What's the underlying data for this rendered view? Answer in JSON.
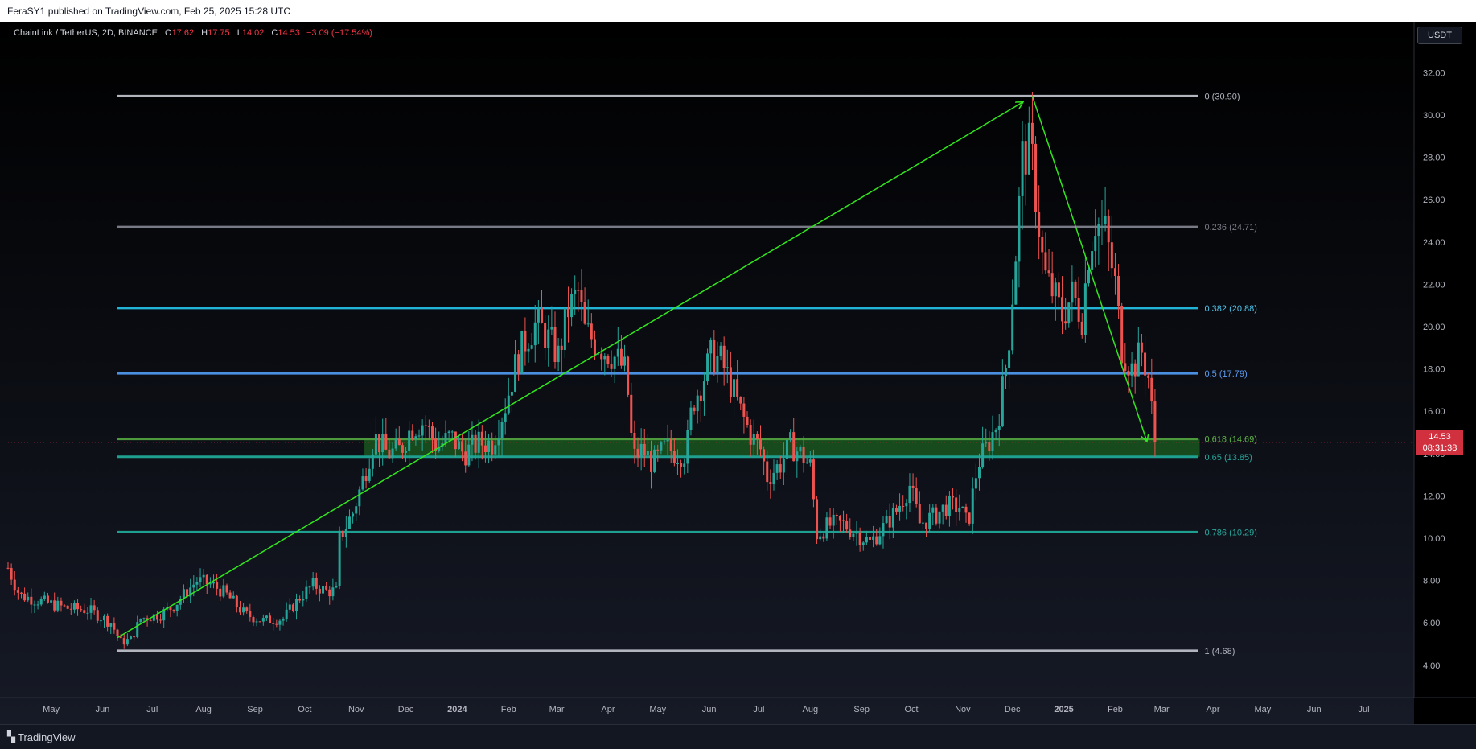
{
  "header": {
    "published_text": "FeraSY1 published on TradingView.com, Feb 25, 2025 15:28 UTC"
  },
  "footer": {
    "brand_text": "TradingView",
    "logo_icon": "tradingview-logo-icon"
  },
  "legend": {
    "symbol": "ChainLink / TetherUS, 2D, BINANCE",
    "open_label": "O",
    "open": "17.62",
    "high_label": "H",
    "high": "17.75",
    "low_label": "L",
    "low": "14.02",
    "close_label": "C",
    "close": "14.53",
    "change": "−3.09 (−17.54%)"
  },
  "currency_button": "USDT",
  "last_price": {
    "price": "14.53",
    "countdown": "08:31:38"
  },
  "colors": {
    "background": "#000000",
    "up": "#26a69a",
    "down": "#ef5350",
    "trendline": "#32e61e",
    "zone": "#1b5e20"
  },
  "chart_data": {
    "type": "candlestick",
    "title": "ChainLink / TetherUS, 2D, BINANCE",
    "ylim": [
      2.7,
      33.5
    ],
    "xlim": [
      "2023-04-05",
      "2025-07-25"
    ],
    "y_ticks": [
      "4.00",
      "6.00",
      "8.00",
      "10.00",
      "12.00",
      "14.00",
      "16.00",
      "18.00",
      "20.00",
      "22.00",
      "24.00",
      "26.00",
      "28.00",
      "30.00",
      "32.00"
    ],
    "x_ticks": [
      {
        "label": "May",
        "date": "2023-05-01",
        "bold": false
      },
      {
        "label": "Jun",
        "date": "2023-06-01",
        "bold": false
      },
      {
        "label": "Jul",
        "date": "2023-07-01",
        "bold": false
      },
      {
        "label": "Aug",
        "date": "2023-08-01",
        "bold": false
      },
      {
        "label": "Sep",
        "date": "2023-09-01",
        "bold": false
      },
      {
        "label": "Oct",
        "date": "2023-10-01",
        "bold": false
      },
      {
        "label": "Nov",
        "date": "2023-11-01",
        "bold": false
      },
      {
        "label": "Dec",
        "date": "2023-12-01",
        "bold": false
      },
      {
        "label": "2024",
        "date": "2024-01-01",
        "bold": true
      },
      {
        "label": "Feb",
        "date": "2024-02-01",
        "bold": false
      },
      {
        "label": "Mar",
        "date": "2024-03-01",
        "bold": false
      },
      {
        "label": "Apr",
        "date": "2024-04-01",
        "bold": false
      },
      {
        "label": "May",
        "date": "2024-05-01",
        "bold": false
      },
      {
        "label": "Jun",
        "date": "2024-06-01",
        "bold": false
      },
      {
        "label": "Jul",
        "date": "2024-07-01",
        "bold": false
      },
      {
        "label": "Aug",
        "date": "2024-08-01",
        "bold": false
      },
      {
        "label": "Sep",
        "date": "2024-09-01",
        "bold": false
      },
      {
        "label": "Oct",
        "date": "2024-10-01",
        "bold": false
      },
      {
        "label": "Nov",
        "date": "2024-11-01",
        "bold": false
      },
      {
        "label": "Dec",
        "date": "2024-12-01",
        "bold": false
      },
      {
        "label": "2025",
        "date": "2025-01-01",
        "bold": true
      },
      {
        "label": "Feb",
        "date": "2025-02-01",
        "bold": false
      },
      {
        "label": "Mar",
        "date": "2025-03-01",
        "bold": false
      },
      {
        "label": "Apr",
        "date": "2025-04-01",
        "bold": false
      },
      {
        "label": "May",
        "date": "2025-05-01",
        "bold": false
      },
      {
        "label": "Jun",
        "date": "2025-06-01",
        "bold": false
      },
      {
        "label": "Jul",
        "date": "2025-07-01",
        "bold": false
      }
    ],
    "fib_levels": [
      {
        "ratio": "0",
        "value": 30.9,
        "label": "0 (30.90)",
        "color": "#b2b5be",
        "label_color": "#b2b5be"
      },
      {
        "ratio": "0.236",
        "value": 24.71,
        "label": "0.236 (24.71)",
        "color": "#787b86",
        "label_color": "#787b86"
      },
      {
        "ratio": "0.382",
        "value": 20.88,
        "label": "0.382 (20.88)",
        "color": "#22b4d6",
        "label_color": "#4fc3e8"
      },
      {
        "ratio": "0.5",
        "value": 17.79,
        "label": "0.5 (17.79)",
        "color": "#4a8fe0",
        "label_color": "#5b9cf0"
      },
      {
        "ratio": "0.618",
        "value": 14.69,
        "label": "0.618 (14.69)",
        "color": "#4c9a3c",
        "label_color": "#5fb548"
      },
      {
        "ratio": "0.65",
        "value": 13.85,
        "label": "0.65 (13.85)",
        "color": "#1e9f8f",
        "label_color": "#26a69a"
      },
      {
        "ratio": "0.786",
        "value": 10.29,
        "label": "0.786 (10.29)",
        "color": "#1e9f8f",
        "label_color": "#26a69a"
      },
      {
        "ratio": "1",
        "value": 4.68,
        "label": "1 (4.68)",
        "color": "#b2b5be",
        "label_color": "#b2b5be"
      }
    ],
    "fib_start_date": "2023-06-10",
    "fib_end_date": "2025-03-23",
    "zone": {
      "from_date": "2023-11-06",
      "to_date": "2025-03-24",
      "low": 13.85,
      "high": 14.69
    },
    "arrows": [
      {
        "from": {
          "date": "2023-06-10",
          "value": 5.3
        },
        "to": {
          "date": "2024-12-07",
          "value": 30.6
        }
      },
      {
        "from": {
          "date": "2024-12-13",
          "value": 30.9
        },
        "to": {
          "date": "2025-02-20",
          "value": 14.6
        }
      }
    ],
    "anchors": [
      [
        "2023-04-05",
        8.6
      ],
      [
        "2023-04-12",
        7.3
      ],
      [
        "2023-04-26",
        7.0
      ],
      [
        "2023-05-10",
        6.7
      ],
      [
        "2023-05-24",
        6.6
      ],
      [
        "2023-06-06",
        6.0
      ],
      [
        "2023-06-12",
        5.1
      ],
      [
        "2023-06-18",
        5.2
      ],
      [
        "2023-06-24",
        6.2
      ],
      [
        "2023-07-06",
        6.4
      ],
      [
        "2023-07-14",
        6.8
      ],
      [
        "2023-07-22",
        7.5
      ],
      [
        "2023-07-28",
        8.0
      ],
      [
        "2023-08-06",
        7.8
      ],
      [
        "2023-08-14",
        7.4
      ],
      [
        "2023-08-20",
        6.9
      ],
      [
        "2023-08-26",
        6.4
      ],
      [
        "2023-09-06",
        6.1
      ],
      [
        "2023-09-18",
        6.2
      ],
      [
        "2023-09-28",
        7.2
      ],
      [
        "2023-10-06",
        7.8
      ],
      [
        "2023-10-14",
        7.5
      ],
      [
        "2023-10-20",
        7.5
      ],
      [
        "2023-10-22",
        10.0
      ],
      [
        "2023-10-30",
        11.2
      ],
      [
        "2023-11-06",
        13.0
      ],
      [
        "2023-11-12",
        14.8
      ],
      [
        "2023-11-20",
        14.0
      ],
      [
        "2023-11-28",
        14.2
      ],
      [
        "2023-12-04",
        15.2
      ],
      [
        "2023-12-12",
        15.5
      ],
      [
        "2023-12-20",
        14.3
      ],
      [
        "2023-12-28",
        14.8
      ],
      [
        "2024-01-05",
        14.0
      ],
      [
        "2024-01-14",
        14.5
      ],
      [
        "2024-01-22",
        14.5
      ],
      [
        "2024-01-30",
        16.3
      ],
      [
        "2024-02-06",
        18.4
      ],
      [
        "2024-02-12",
        19.5
      ],
      [
        "2024-02-18",
        20.2
      ],
      [
        "2024-02-26",
        19.3
      ],
      [
        "2024-03-02",
        18.6
      ],
      [
        "2024-03-08",
        20.8
      ],
      [
        "2024-03-14",
        21.6
      ],
      [
        "2024-03-18",
        19.8
      ],
      [
        "2024-03-24",
        19.3
      ],
      [
        "2024-03-30",
        18.9
      ],
      [
        "2024-04-06",
        18.5
      ],
      [
        "2024-04-12",
        17.8
      ],
      [
        "2024-04-16",
        13.8
      ],
      [
        "2024-04-22",
        14.2
      ],
      [
        "2024-04-28",
        13.5
      ],
      [
        "2024-05-06",
        14.3
      ],
      [
        "2024-05-12",
        14.0
      ],
      [
        "2024-05-18",
        14.0
      ],
      [
        "2024-05-22",
        16.4
      ],
      [
        "2024-05-28",
        17.4
      ],
      [
        "2024-06-02",
        18.6
      ],
      [
        "2024-06-08",
        18.4
      ],
      [
        "2024-06-14",
        17.3
      ],
      [
        "2024-06-20",
        16.0
      ],
      [
        "2024-06-26",
        14.9
      ],
      [
        "2024-07-02",
        14.2
      ],
      [
        "2024-07-06",
        12.9
      ],
      [
        "2024-07-14",
        13.5
      ],
      [
        "2024-07-20",
        14.4
      ],
      [
        "2024-07-26",
        14.0
      ],
      [
        "2024-08-01",
        13.4
      ],
      [
        "2024-08-05",
        10.2
      ],
      [
        "2024-08-12",
        10.6
      ],
      [
        "2024-08-20",
        10.7
      ],
      [
        "2024-08-28",
        10.3
      ],
      [
        "2024-09-06",
        9.8
      ],
      [
        "2024-09-14",
        10.5
      ],
      [
        "2024-09-22",
        11.3
      ],
      [
        "2024-09-30",
        12.5
      ],
      [
        "2024-10-06",
        10.7
      ],
      [
        "2024-10-14",
        11.0
      ],
      [
        "2024-10-22",
        11.5
      ],
      [
        "2024-10-30",
        11.5
      ],
      [
        "2024-11-04",
        10.6
      ],
      [
        "2024-11-10",
        13.5
      ],
      [
        "2024-11-16",
        14.4
      ],
      [
        "2024-11-22",
        15.5
      ],
      [
        "2024-11-28",
        18.6
      ],
      [
        "2024-12-03",
        23.5
      ],
      [
        "2024-12-07",
        28.0
      ],
      [
        "2024-12-12",
        28.5
      ],
      [
        "2024-12-16",
        25.5
      ],
      [
        "2024-12-20",
        22.5
      ],
      [
        "2024-12-26",
        21.5
      ],
      [
        "2024-12-31",
        20.5
      ],
      [
        "2025-01-06",
        21.5
      ],
      [
        "2025-01-12",
        20.5
      ],
      [
        "2025-01-16",
        23.5
      ],
      [
        "2025-01-20",
        25.0
      ],
      [
        "2025-01-26",
        24.5
      ],
      [
        "2025-02-01",
        22.0
      ],
      [
        "2025-02-05",
        19.0
      ],
      [
        "2025-02-11",
        18.0
      ],
      [
        "2025-02-17",
        18.8
      ],
      [
        "2025-02-21",
        17.6
      ],
      [
        "2025-02-25",
        14.53
      ]
    ]
  }
}
